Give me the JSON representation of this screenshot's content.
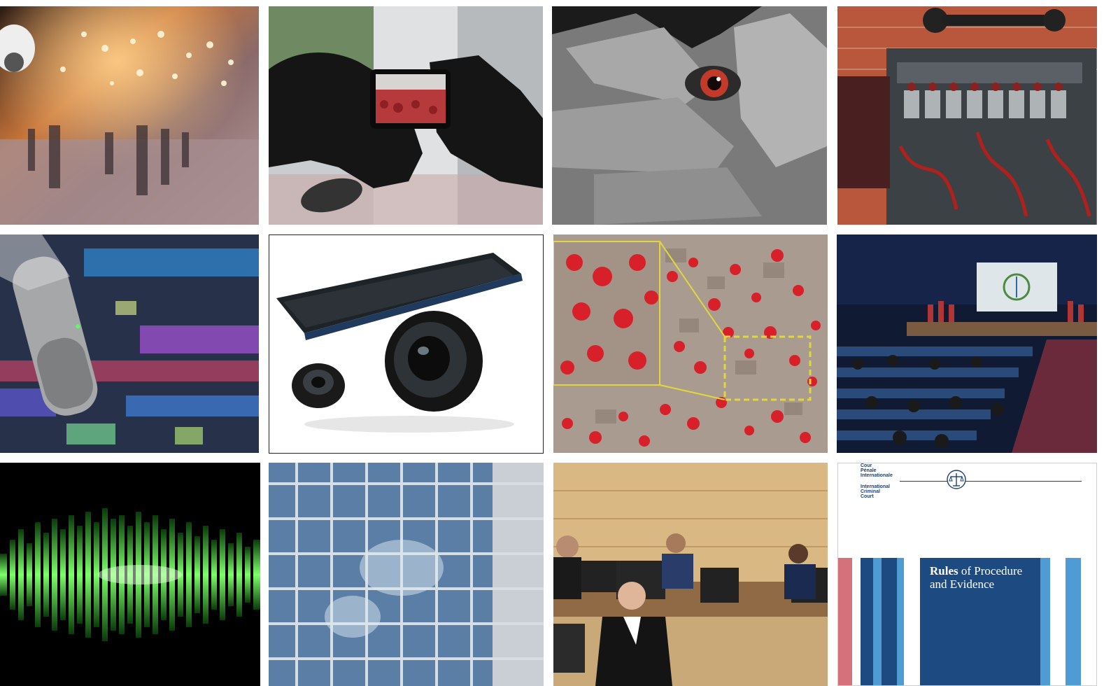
{
  "grid": {
    "tiles": [
      {
        "subject": "surveillance-camera-street-crowd"
      },
      {
        "subject": "smartphone-filming-protest"
      },
      {
        "subject": "eye-through-fingers"
      },
      {
        "subject": "vintage-field-telephone-switchboard"
      },
      {
        "subject": "studio-microphone-audio-editor"
      },
      {
        "subject": "smartphone-and-lenses"
      },
      {
        "subject": "satellite-image-burned-village"
      },
      {
        "subject": "assembly-of-states-parties-hall"
      },
      {
        "subject": "green-audio-waveform"
      },
      {
        "subject": "glass-office-building"
      },
      {
        "subject": "courtroom-judges-and-counsel"
      },
      {
        "subject": "rules-of-procedure-cover"
      }
    ]
  },
  "cover": {
    "org_french": [
      "Cour",
      "Pénale",
      "Internationale"
    ],
    "org_english": [
      "International",
      "Criminal",
      "Court"
    ],
    "title_bold": "Rules",
    "title_rest": " of Procedure",
    "title_line2": "and Evidence",
    "colors": {
      "navy": "#1d4a80",
      "light_blue": "#4f9bd4",
      "pink": "#d5717b",
      "mid_blue": "#2e6aa5"
    }
  }
}
